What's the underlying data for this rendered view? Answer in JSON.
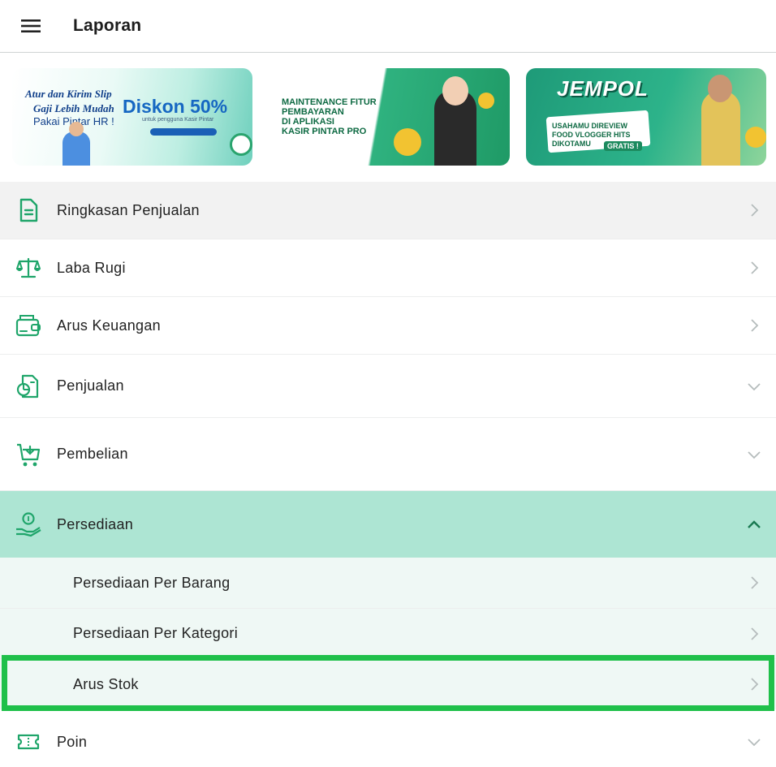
{
  "header": {
    "title": "Laporan",
    "menu_icon": "hamburger-icon"
  },
  "banners": [
    {
      "name": "pintar-hr",
      "line1": "Atur dan Kirim Slip",
      "line2": "Gaji Lebih Mudah",
      "line3": "Pakai Pintar HR !",
      "headline": "Diskon 50%",
      "sub": "untuk pengguna Kasir Pintar"
    },
    {
      "name": "maintenance",
      "line1": "MAINTENANCE FITUR",
      "line2": "PEMBAYARAN",
      "line3": "DI APLIKASI",
      "line4": "KASIR PINTAR PRO"
    },
    {
      "name": "jempol",
      "headline": "JEMPOL",
      "line1": "USAHAMU DIREVIEW",
      "line2": "FOOD VLOGGER HITS",
      "line3": "DIKOTAMU",
      "badge": "GRATIS !"
    }
  ],
  "menu": [
    {
      "label": "Ringkasan Penjualan",
      "icon": "document-icon",
      "chevron": "chevron-right-icon"
    },
    {
      "label": "Laba Rugi",
      "icon": "scale-icon",
      "chevron": "chevron-right-icon"
    },
    {
      "label": "Arus Keuangan",
      "icon": "wallet-icon",
      "chevron": "chevron-right-icon"
    },
    {
      "label": "Penjualan",
      "icon": "sales-chart-icon",
      "chevron": "chevron-down-icon"
    },
    {
      "label": "Pembelian",
      "icon": "cart-icon",
      "chevron": "chevron-down-icon"
    },
    {
      "label": "Persediaan",
      "icon": "inventory-hand-icon",
      "chevron": "chevron-up-icon"
    },
    {
      "label": "Poin",
      "icon": "ticket-icon",
      "chevron": "chevron-down-icon"
    }
  ],
  "submenu": [
    {
      "label": "Persediaan Per Barang",
      "chevron": "chevron-right-icon"
    },
    {
      "label": "Persediaan Per Kategori",
      "chevron": "chevron-right-icon"
    },
    {
      "label": "Arus Stok",
      "chevron": "chevron-right-icon"
    }
  ],
  "colors": {
    "accent": "#1fa56a",
    "expanded_bg": "#ade5d3",
    "sub_bg": "#eff8f5",
    "highlight": "#1fc04a",
    "first_row_bg": "#f2f2f2"
  }
}
